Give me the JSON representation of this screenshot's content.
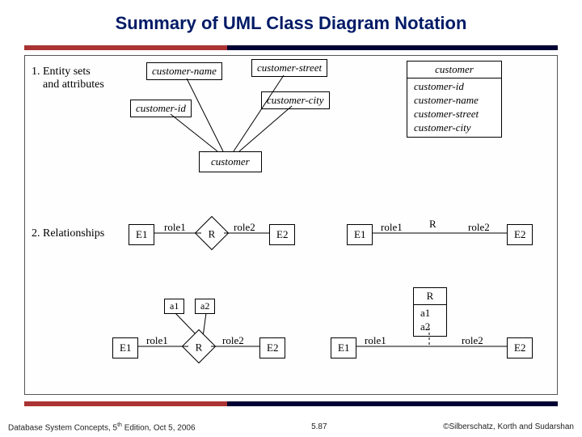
{
  "title": "Summary of UML Class Diagram Notation",
  "footer": {
    "left_prefix": "Database System Concepts, 5",
    "left_sup": "th",
    "left_suffix": " Edition, Oct 5, 2006",
    "center": "5.87",
    "right": "©Silberschatz, Korth and Sudarshan"
  },
  "section1": {
    "label": "1. Entity sets\n    and attributes",
    "attrs": {
      "name": "customer-name",
      "street": "customer-street",
      "id": "customer-id",
      "city": "customer-city"
    },
    "entity": "customer",
    "class": {
      "name": "customer",
      "attrs": [
        "customer-id",
        "customer-name",
        "customer-street",
        "customer-city"
      ]
    }
  },
  "section2": {
    "label": "2. Relationships",
    "er": {
      "e1": "E1",
      "e2": "E2",
      "r": "R",
      "role1": "role1",
      "role2": "role2"
    },
    "uml": {
      "e1": "E1",
      "e2": "E2",
      "r": "R",
      "role1": "role1",
      "role2": "role2"
    }
  },
  "section3": {
    "er": {
      "e1": "E1",
      "e2": "E2",
      "r": "R",
      "role1": "role1",
      "role2": "role2",
      "a1": "a1",
      "a2": "a2"
    },
    "uml": {
      "e1": "E1",
      "e2": "E2",
      "role1": "role1",
      "role2": "role2",
      "assoc": {
        "name": "R",
        "attrs": [
          "a1",
          "a2"
        ]
      }
    }
  }
}
